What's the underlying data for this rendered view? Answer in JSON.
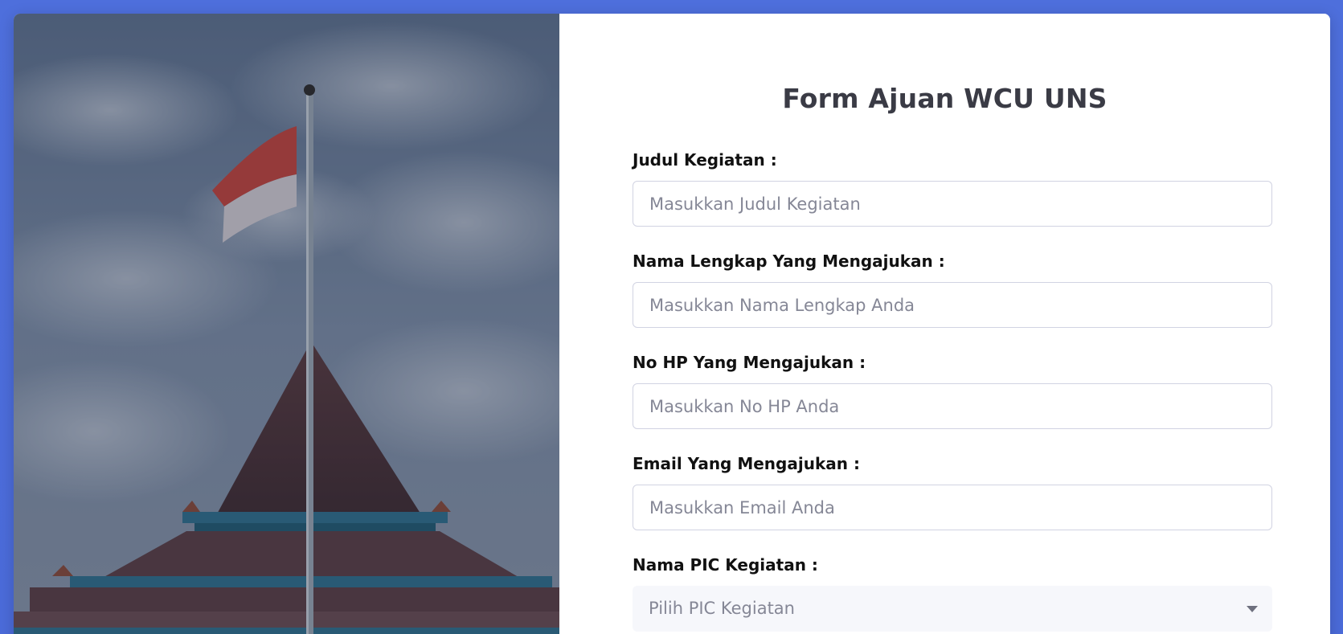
{
  "form": {
    "title": "Form Ajuan WCU UNS",
    "fields": [
      {
        "label": "Judul Kegiatan :",
        "placeholder": "Masukkan Judul Kegiatan",
        "value": ""
      },
      {
        "label": "Nama Lengkap Yang Mengajukan :",
        "placeholder": "Masukkan Nama Lengkap Anda",
        "value": ""
      },
      {
        "label": "No HP Yang Mengajukan :",
        "placeholder": "Masukkan No HP Anda",
        "value": ""
      },
      {
        "label": "Email Yang Mengajukan :",
        "placeholder": "Masukkan Email Anda",
        "value": ""
      }
    ],
    "pic": {
      "label": "Nama PIC Kegiatan :",
      "selected": "Pilih PIC Kegiatan"
    }
  },
  "colors": {
    "background": "#4e73df",
    "title": "#3a3b45",
    "label": "#111111",
    "placeholder": "#858796",
    "input_border": "#d1d3e2",
    "select_bg": "#f6f7fb"
  },
  "image": {
    "subject": "building-with-flag-photo"
  }
}
